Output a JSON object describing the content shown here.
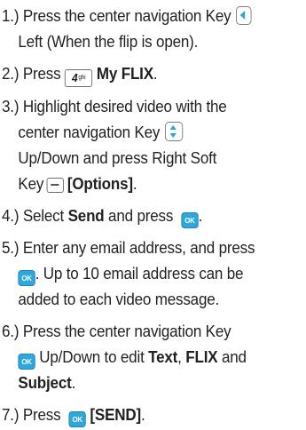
{
  "steps": [
    {
      "line1": "1.) Press the center navigation Key",
      "line2": "Left (When the flip is open).",
      "icon": "left-nav-key-icon"
    },
    {
      "num": "2.) Press",
      "key_number": "4",
      "key_letters": "ghi",
      "label": "My FLIX",
      "period": "."
    },
    {
      "line1": "3.) Highlight desired video with the",
      "line2": "center navigation Key",
      "line3": "Up/Down and press Right Soft",
      "line4": "Key",
      "options": "[Options]",
      "period": "."
    },
    {
      "pre": "4.) Select",
      "send": "Send",
      "and_press": "and press",
      "period": "."
    },
    {
      "line1": "5.) Enter any email address, and press",
      "line2_text": ". Up to 10 email address can be",
      "line3": "added to each video message."
    },
    {
      "line1": "6.) Press the center navigation Key",
      "line2_text": "Up/Down to edit",
      "text_label": "Text",
      "comma": ",",
      "flix_label": "FLIX",
      "and_word": "and",
      "subject_label": "Subject",
      "period": "."
    },
    {
      "pre": "7.) Press",
      "send_bracket": "[SEND]",
      "period": "."
    }
  ],
  "ok_key_label": "OK",
  "colors": {
    "text": "#231f20",
    "accent": "#2ea7dc",
    "key_border": "#7d7d7d"
  }
}
